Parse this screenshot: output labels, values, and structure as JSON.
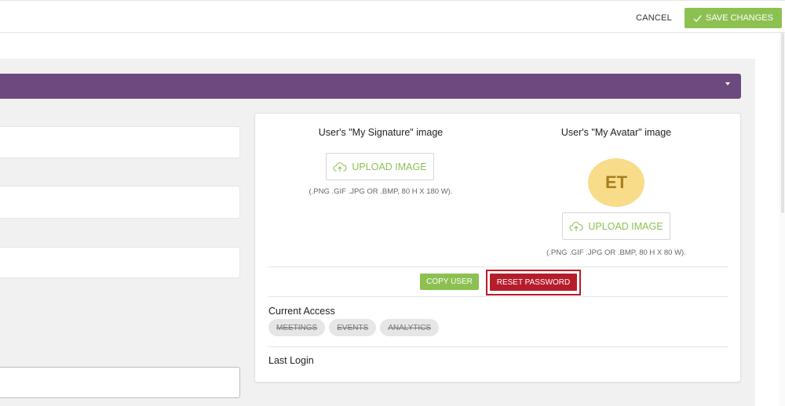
{
  "toolbar": {
    "cancel_label": "CANCEL",
    "save_label": "SAVE CHANGES",
    "save_icon": "check-icon"
  },
  "colors": {
    "accent_green": "#8cc152",
    "header_purple": "#6c4a7f",
    "danger_red": "#b71c2b",
    "avatar_bg": "#f8dc8a"
  },
  "signature": {
    "title": "User's \"My Signature\" image",
    "upload_label": "UPLOAD IMAGE",
    "upload_icon": "cloud-upload-icon",
    "hint": "(.PNG .GIF .JPG OR .BMP, 80 H X 180 W)."
  },
  "avatar": {
    "title": "User's \"My Avatar\" image",
    "initials": "ET",
    "upload_label": "UPLOAD IMAGE",
    "upload_icon": "cloud-upload-icon",
    "hint": "(.PNG .GIF .JPG OR .BMP, 80 H X 80 W)."
  },
  "actions": {
    "copy_user_label": "COPY USER",
    "reset_password_label": "RESET PASSWORD"
  },
  "access": {
    "label": "Current Access",
    "items": [
      "MEETINGS",
      "EVENTS",
      "ANALYTICS"
    ]
  },
  "login": {
    "label": "Last Login"
  }
}
